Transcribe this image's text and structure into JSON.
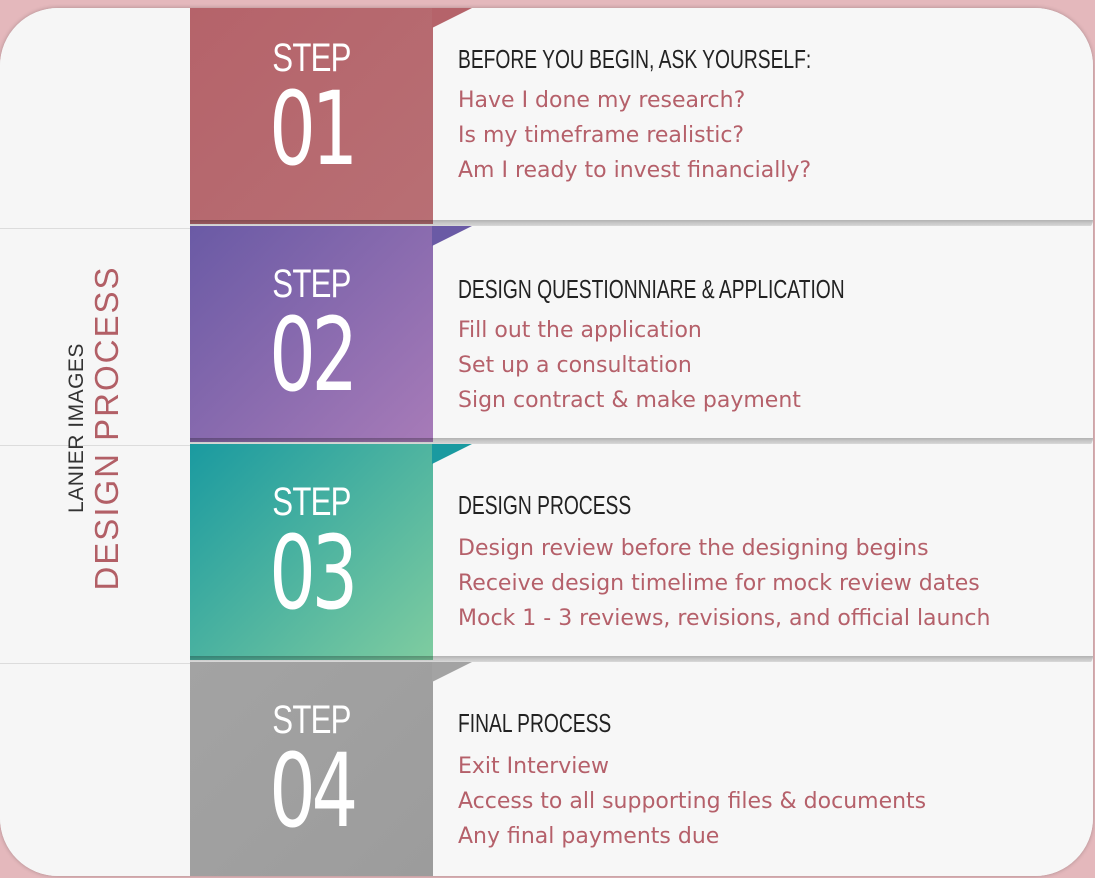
{
  "sidebar": {
    "subtitle": "LANIER IMAGES",
    "title": "DESIGN PROCESS"
  },
  "steps": [
    {
      "label": "STEP",
      "number": "01",
      "color_top": "#b5636a",
      "color_bottom": "#b86f74",
      "heading": "BEFORE YOU BEGIN, ASK YOURSELF:",
      "items": [
        "Have I done my research?",
        "Is my timeframe realistic?",
        "Am I ready to invest financially?"
      ]
    },
    {
      "label": "STEP",
      "number": "02",
      "color_top": "#6a5aa5",
      "color_bottom": "#a77bb8",
      "heading": "DESIGN QUESTIONNIARE & APPLICATION",
      "items": [
        "Fill out the application",
        "Set up a consultation",
        "Sign contract & make payment"
      ]
    },
    {
      "label": "STEP",
      "number": "03",
      "color_top": "#1a9aa0",
      "color_bottom": "#7fcca0",
      "heading": "DESIGN PROCESS",
      "items": [
        "Design review before the designing begins",
        "Receive design timelime for mock review dates",
        "Mock 1 - 3 reviews, revisions, and official launch"
      ]
    },
    {
      "label": "STEP",
      "number": "04",
      "color_top": "#a3a3a3",
      "color_bottom": "#9c9c9c",
      "heading": "FINAL PROCESS",
      "items": [
        "Exit Interview",
        "Access to all supporting files & documents",
        "Any final payments due"
      ]
    }
  ]
}
